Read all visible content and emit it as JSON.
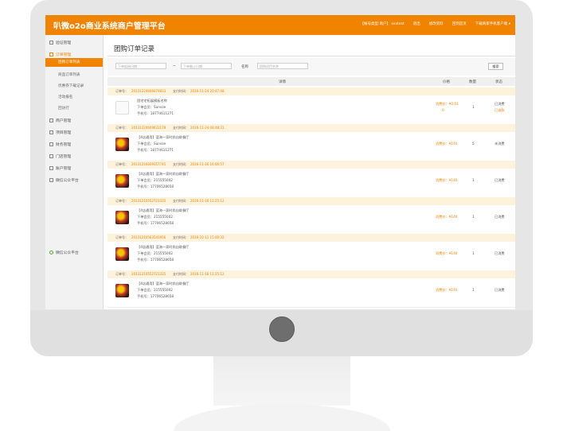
{
  "app": {
    "title": "叭微o2o商业系统商户管理平台"
  },
  "header_links": [
    "【帐号类型:商户】 sxxtest",
    "退出",
    "修改资料",
    "回到首页",
    "下载商家手机客户端"
  ],
  "sidebar": {
    "items": [
      {
        "label": "验证管理"
      },
      {
        "label": "订单管理"
      },
      {
        "label": "商户管理"
      },
      {
        "label": "项目管理"
      },
      {
        "label": "财务管理"
      },
      {
        "label": "门店管理"
      },
      {
        "label": "账户管理"
      },
      {
        "label": "微信公众平台"
      }
    ],
    "subitems": [
      {
        "label": "团购订单列表"
      },
      {
        "label": "商品订单列表"
      },
      {
        "label": "优惠券下载记录"
      },
      {
        "label": "活动报名"
      },
      {
        "label": "回访行"
      }
    ],
    "footer": "微信公众平台"
  },
  "page": {
    "title": "团购订单记录",
    "filter": {
      "start_placeholder": "下单起始日期",
      "sep": "~",
      "end_placeholder": "下单截止日期",
      "name_label": "名称",
      "name_placeholder": "团购项目名称",
      "search_label": "搜索"
    },
    "columns": [
      "详情",
      "价格",
      "数量",
      "状态"
    ]
  },
  "orders": [
    {
      "sn_label": "订单号：",
      "sn": "20131224606674833",
      "time_label": "支付时间：",
      "time": "2016-11-24 20:47:48",
      "title": "团宅宅拓展模板名称",
      "buyer": "下单会员：Sunsoe",
      "phone": "手机号：18774611271",
      "price": "消费价：¥0.01",
      "price2": "0",
      "qty": "1",
      "status": "已消费",
      "status2": "已退款",
      "plain": true
    },
    {
      "sn_label": "订单号：",
      "sn": "20131224609632178",
      "time_label": "支付时间：",
      "time": "2016-11-24 08:48:31",
      "title": "【4店通用】蓝海一家时尚自助餐厅",
      "buyer": "下单会员：Sunsoe",
      "phone": "手机号：18774611271",
      "price": "消费价：¥140",
      "qty": "5",
      "status": "未消费"
    },
    {
      "sn_label": "订单号：",
      "sn": "20131216609357745",
      "time_label": "支付时间：",
      "time": "2016-11-16 16:06:57",
      "title": "【4店通用】蓝海一家时尚自助餐厅",
      "buyer": "下单会员：215555002",
      "phone": "手机号：17706528658",
      "price": "消费价：¥140",
      "qty": "1",
      "status": "已消费"
    },
    {
      "sn_label": "订单号：",
      "sn": "20131210552721335",
      "time_label": "支付时间：",
      "time": "2016-11-16 11:25:12",
      "title": "【4店通用】蓝海一家时尚自助餐厅",
      "buyer": "下单会员：215555002",
      "phone": "手机号：17706528658",
      "price": "消费价：¥140",
      "qty": "1",
      "status": "已消费"
    },
    {
      "sn_label": "订单号：",
      "sn": "20131210563541956",
      "time_label": "支付时间：",
      "time": "2016-10-11 15:00:32",
      "title": "【4店通用】蓝海一家时尚自助餐厅",
      "buyer": "下单会员：215555002",
      "phone": "手机号：17706528658",
      "price": "消费价：¥140",
      "qty": "1",
      "status": "已消费"
    },
    {
      "sn_label": "订单号：",
      "sn": "20131210552721335",
      "time_label": "支付时间：",
      "time": "2016-11-16 11:25:12",
      "title": "【4店通用】蓝海一家时尚自助餐厅",
      "buyer": "下单会员：215555002",
      "phone": "手机号：17706528658",
      "price": "消费价：¥140",
      "qty": "1",
      "status": "已消费"
    }
  ]
}
